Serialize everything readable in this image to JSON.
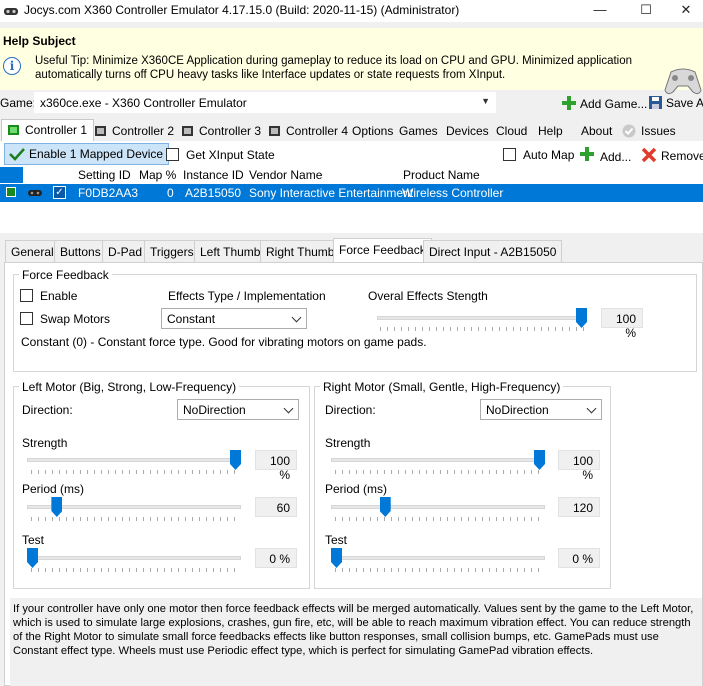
{
  "window": {
    "title": "Jocys.com X360 Controller Emulator 4.17.15.0 (Build: 2020-11-15) (Administrator)",
    "minimize": "—",
    "maximize": "☐",
    "close": "✕"
  },
  "help": {
    "subject": "Help Subject",
    "text": "Useful Tip: Minimize X360CE Application during gameplay to reduce its load on CPU and GPU. Minimized application automatically turns off CPU heavy tasks like Interface updates or state requests from XInput."
  },
  "game": {
    "label": "Game:",
    "selected": "x360ce.exe - X360 Controller Emulator",
    "add_game": "Add Game...",
    "save": "Save Al"
  },
  "main_tabs": [
    "Controller 1",
    "Controller 2",
    "Controller 3",
    "Controller 4",
    "Options",
    "Games",
    "Devices",
    "Cloud",
    "Help",
    "About",
    "Issues"
  ],
  "toolbar": {
    "enable_mapped": "Enable 1 Mapped Device",
    "get_xinput": "Get XInput State",
    "auto_map": "Auto Map",
    "add": "Add...",
    "remove": "Remove"
  },
  "grid": {
    "headers": [
      "Setting ID",
      "Map %",
      "Instance ID",
      "Vendor Name",
      "Product Name"
    ],
    "row": {
      "setting_id": "F0DB2AA3",
      "map": "0",
      "instance_id": "A2B15050",
      "vendor": "Sony Interactive Entertainment",
      "product": "Wireless Controller"
    }
  },
  "sub_tabs": [
    "General",
    "Buttons",
    "D-Pad",
    "Triggers",
    "Left Thumb",
    "Right Thumb",
    "Force Feedback",
    "Direct Input - A2B15050"
  ],
  "ff": {
    "group": "Force Feedback",
    "enable": "Enable",
    "swap": "Swap Motors",
    "effects_label": "Effects Type / Implementation",
    "effects_value": "Constant",
    "overall_label": "Overal Effects Stength",
    "overall_value": "100 %",
    "overall_level": 100,
    "desc": "Constant (0) - Constant force type. Good for vibrating motors on game pads."
  },
  "left_motor": {
    "group": "Left Motor (Big, Strong, Low-Frequency)",
    "direction_label": "Direction:",
    "direction": "NoDirection",
    "strength_label": "Strength",
    "strength": "100 %",
    "strength_level": 100,
    "period_label": "Period (ms)",
    "period": "60",
    "period_level": 12,
    "test_label": "Test",
    "test": "0 %",
    "test_level": 0
  },
  "right_motor": {
    "group": "Right Motor (Small, Gentle, High-Frequency)",
    "direction_label": "Direction:",
    "direction": "NoDirection",
    "strength_label": "Strength",
    "strength": "100 %",
    "strength_level": 100,
    "period_label": "Period (ms)",
    "period": "120",
    "period_level": 24,
    "test_label": "Test",
    "test": "0 %",
    "test_level": 0
  },
  "bottom_text": "If your controller have only one motor then force feedback effects will be merged automatically. Values sent by the game to the Left Motor, which is used to simulate large explosions, crashes, gun fire, etc, will be able to reach maximum vibration effect. You can reduce strength of the Right Motor to simulate small force feedbacks effects like button responses, small collision bumps, etc. GamePads must use Constant effect type. Wheels must use Periodic effect type, which is perfect for simulating GamePad vibration effects.",
  "colors": {
    "selection": "#0078d7",
    "help_bg": "#ffffe1",
    "plus": "#2ea12e",
    "remove": "#e03c2c"
  }
}
